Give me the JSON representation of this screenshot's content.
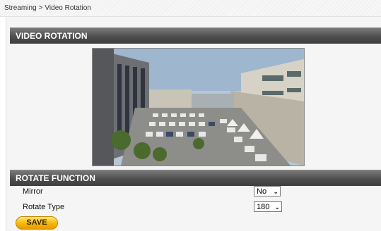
{
  "breadcrumb": {
    "parent": "Streaming",
    "separator": ">",
    "current": "Video Rotation"
  },
  "sections": {
    "video_rotation": "VIDEO ROTATION",
    "rotate_function": "ROTATE FUNCTION"
  },
  "form": {
    "mirror": {
      "label": "Mirror",
      "value": "No"
    },
    "rotate_type": {
      "label": "Rotate Type",
      "value": "180"
    }
  },
  "buttons": {
    "save": "SAVE"
  },
  "icons": {
    "dropdown": "chevron-down-icon"
  },
  "colors": {
    "section_bar": "#4e4e4e",
    "save_button": "#f5b800"
  }
}
